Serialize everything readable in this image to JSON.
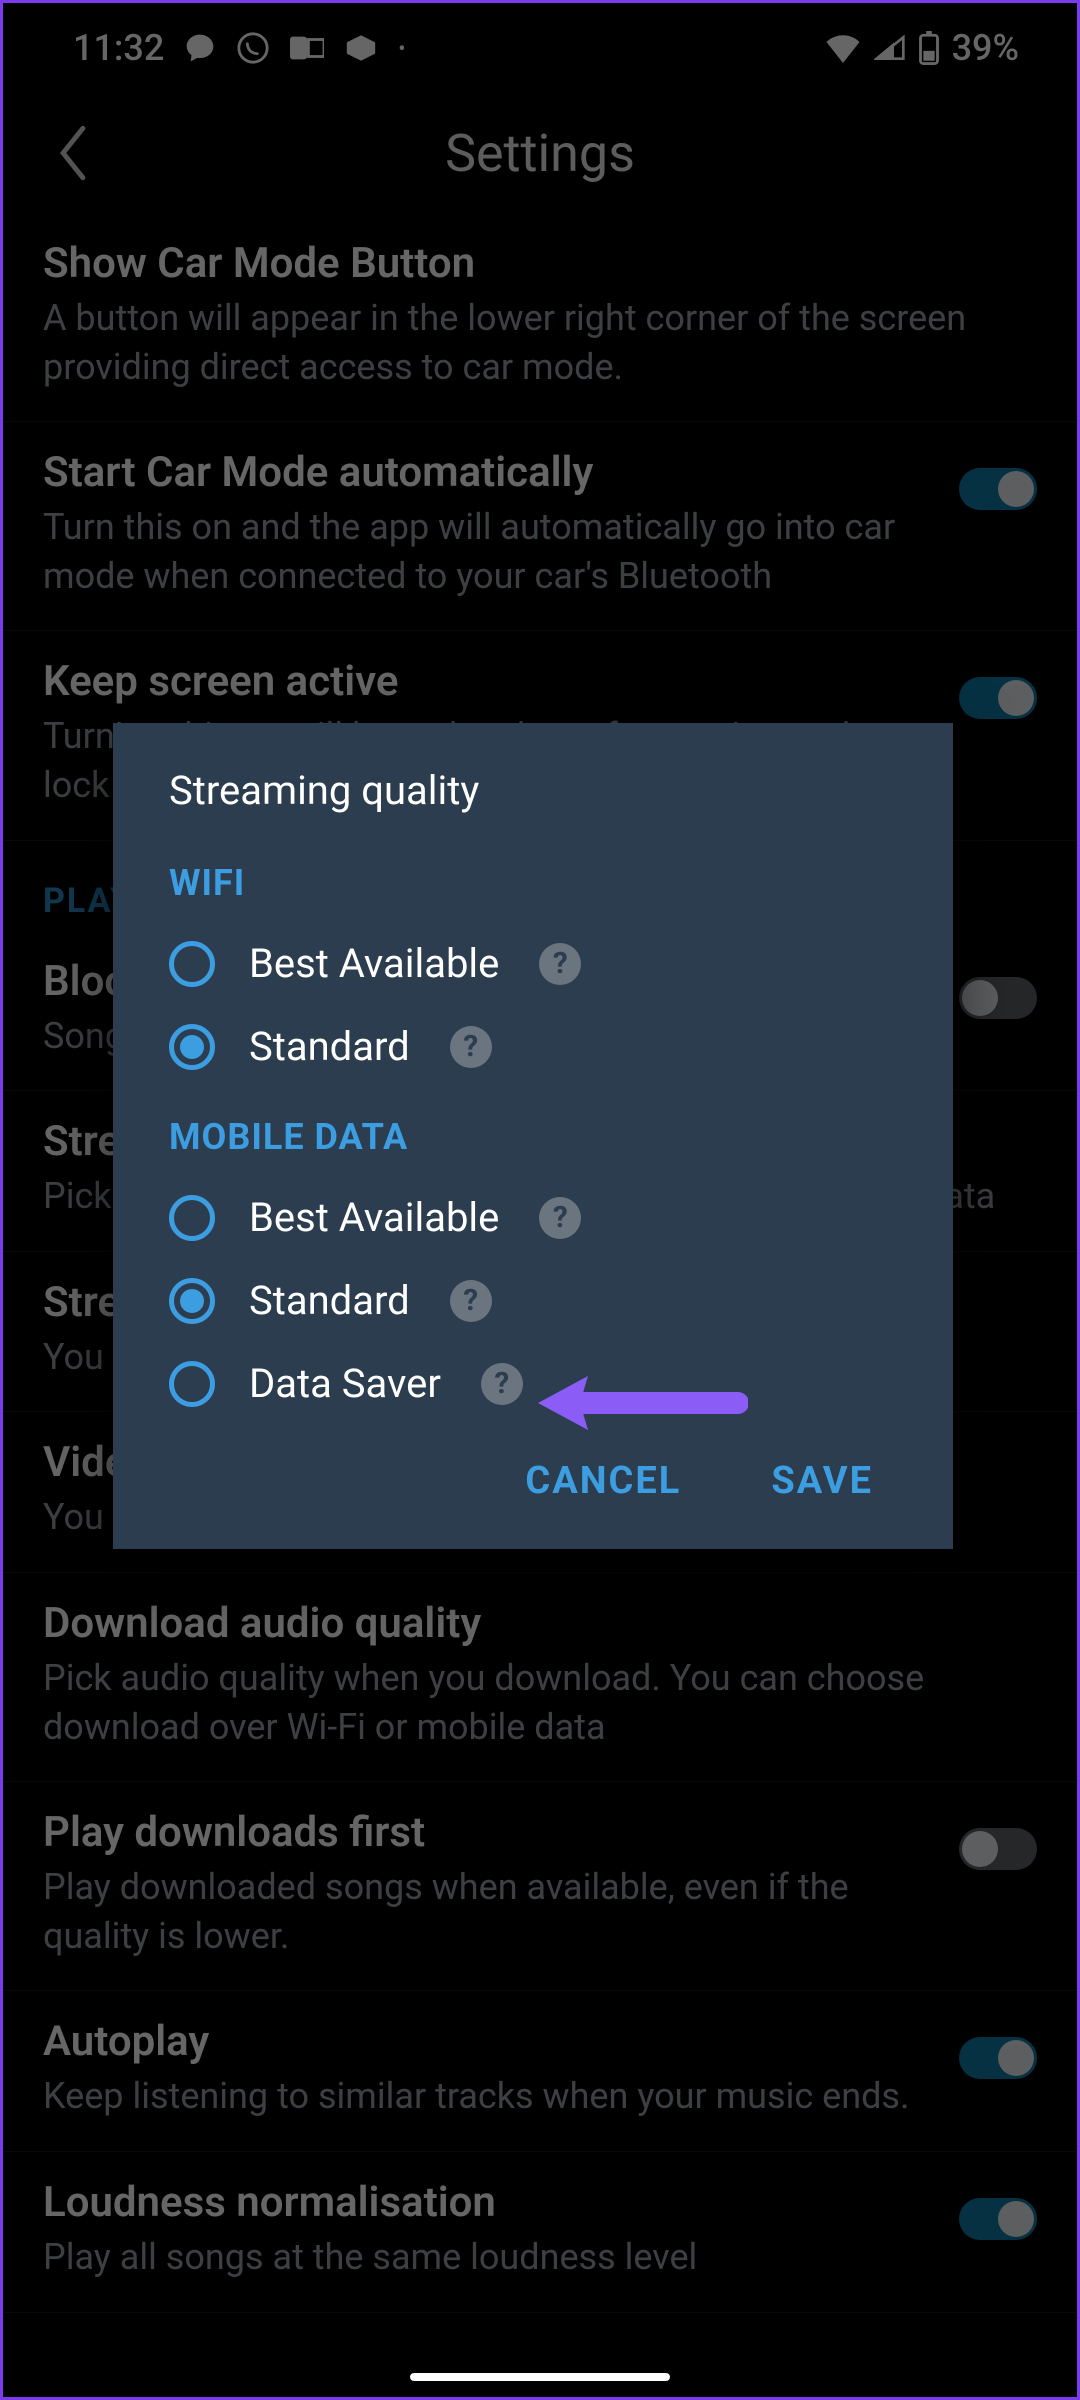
{
  "status": {
    "time": "11:32",
    "battery_text": "39%"
  },
  "header": {
    "title": "Settings"
  },
  "section_header": "PLAYBACK",
  "settings": [
    {
      "title": "Show Car Mode Button",
      "sub": "A button will appear in the lower right corner of the screen providing direct access to car mode.",
      "toggle": null
    },
    {
      "title": "Start Car Mode automatically",
      "sub": "Turn this on and the app will automatically go into car mode when connected to your car's Bluetooth",
      "toggle": true
    },
    {
      "title": "Keep screen active",
      "sub": "Turning this on will keep the phone from going to the lock",
      "toggle": true
    },
    {
      "title": "Block Explicit Songs",
      "sub": "Songs marked explicit won't play on this device.",
      "toggle": false
    },
    {
      "title": "Streaming audio quality",
      "sub": "Pick audio quality when streaming over Wi-Fi or mobile data"
    },
    {
      "title": "Streaming network preference",
      "sub": "You can limit streaming to Wi-Fi only."
    },
    {
      "title": "Video streaming network preference",
      "sub": "You can limit video streaming to specific network types."
    },
    {
      "title": "Download audio quality",
      "sub": "Pick audio quality when you download. You can choose download over Wi-Fi or mobile data"
    },
    {
      "title": "Play downloads first",
      "sub": "Play downloaded songs when available, even if the quality is lower.",
      "toggle": false
    },
    {
      "title": "Autoplay",
      "sub": "Keep listening to similar tracks when your music ends.",
      "toggle": true
    },
    {
      "title": "Loudness normalisation",
      "sub": "Play all songs at the same loudness level",
      "toggle": true
    }
  ],
  "dialog": {
    "title": "Streaming quality",
    "wifi_header": "WIFI",
    "mobile_header": "MOBILE DATA",
    "wifi_options": [
      {
        "label": "Best Available",
        "selected": false
      },
      {
        "label": "Standard",
        "selected": true
      }
    ],
    "mobile_options": [
      {
        "label": "Best Available",
        "selected": false
      },
      {
        "label": "Standard",
        "selected": true
      },
      {
        "label": "Data Saver",
        "selected": false
      }
    ],
    "cancel": "CANCEL",
    "save": "SAVE"
  },
  "annotation": {
    "color": "#8b5cf6"
  }
}
